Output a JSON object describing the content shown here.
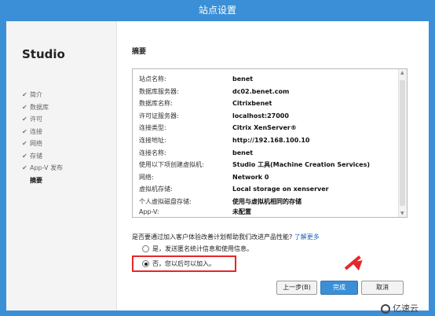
{
  "window": {
    "title": "站点设置"
  },
  "sidebar": {
    "app_title": "Studio",
    "steps": [
      {
        "label": "简介",
        "done": true
      },
      {
        "label": "数据库",
        "done": true
      },
      {
        "label": "许可",
        "done": true
      },
      {
        "label": "连接",
        "done": true
      },
      {
        "label": "网络",
        "done": true
      },
      {
        "label": "存储",
        "done": true
      },
      {
        "label": "App-V 发布",
        "done": true
      },
      {
        "label": "摘要",
        "done": false,
        "current": true
      }
    ]
  },
  "main": {
    "title": "摘要",
    "summary": [
      {
        "label": "站点名称:",
        "value": "benet"
      },
      {
        "label": "数据库服务器:",
        "value": "dc02.benet.com"
      },
      {
        "label": "数据库名称:",
        "value": "Citrixbenet"
      },
      {
        "label": "许可证服务器:",
        "value": "localhost:27000"
      },
      {
        "label": "连接类型:",
        "value": "Citrix XenServer®"
      },
      {
        "label": "连接地址:",
        "value": "http://192.168.100.10"
      },
      {
        "label": "连接名称:",
        "value": "benet"
      },
      {
        "label": "使用以下项创建虚拟机:",
        "value": "Studio 工具(Machine Creation Services)"
      },
      {
        "label": "网络:",
        "value": "Network 0"
      },
      {
        "label": "虚拟机存储:",
        "value": "Local storage on xenserver"
      },
      {
        "label": "个人虚拟磁盘存储:",
        "value": "使用与虚拟机相同的存储"
      },
      {
        "label": "App-V:",
        "value": "未配置"
      }
    ],
    "question": "是否要通过加入客户体验改善计划帮助我们改进产品性能?",
    "learn_more": "了解更多",
    "options": [
      {
        "label": "是，发送匿名统计信息和使用信息。",
        "selected": false
      },
      {
        "label": "否，您以后可以加入。",
        "selected": true
      }
    ]
  },
  "buttons": {
    "back": "上一步(B)",
    "finish": "完成",
    "cancel": "取消"
  },
  "watermark": "亿速云",
  "colors": {
    "frame": "#3a8fd6",
    "highlight": "#e8262a",
    "link": "#1a63b4"
  }
}
